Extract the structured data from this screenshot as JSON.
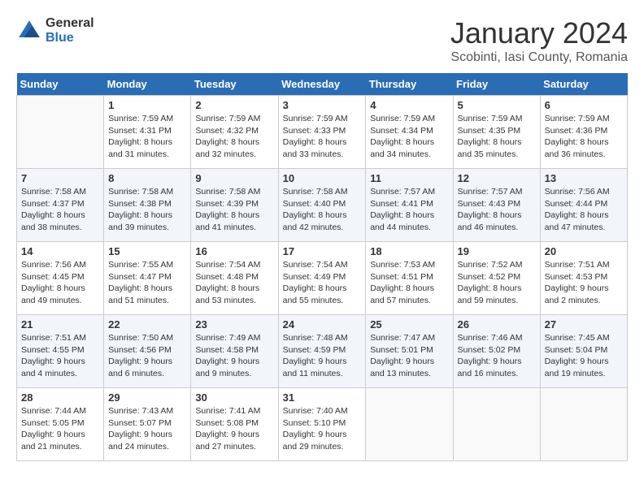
{
  "header": {
    "logo_line1": "General",
    "logo_line2": "Blue",
    "title": "January 2024",
    "subtitle": "Scobinti, Iasi County, Romania"
  },
  "weekdays": [
    "Sunday",
    "Monday",
    "Tuesday",
    "Wednesday",
    "Thursday",
    "Friday",
    "Saturday"
  ],
  "weeks": [
    [
      {
        "num": "",
        "info": ""
      },
      {
        "num": "1",
        "info": "Sunrise: 7:59 AM\nSunset: 4:31 PM\nDaylight: 8 hours\nand 31 minutes."
      },
      {
        "num": "2",
        "info": "Sunrise: 7:59 AM\nSunset: 4:32 PM\nDaylight: 8 hours\nand 32 minutes."
      },
      {
        "num": "3",
        "info": "Sunrise: 7:59 AM\nSunset: 4:33 PM\nDaylight: 8 hours\nand 33 minutes."
      },
      {
        "num": "4",
        "info": "Sunrise: 7:59 AM\nSunset: 4:34 PM\nDaylight: 8 hours\nand 34 minutes."
      },
      {
        "num": "5",
        "info": "Sunrise: 7:59 AM\nSunset: 4:35 PM\nDaylight: 8 hours\nand 35 minutes."
      },
      {
        "num": "6",
        "info": "Sunrise: 7:59 AM\nSunset: 4:36 PM\nDaylight: 8 hours\nand 36 minutes."
      }
    ],
    [
      {
        "num": "7",
        "info": "Sunrise: 7:58 AM\nSunset: 4:37 PM\nDaylight: 8 hours\nand 38 minutes."
      },
      {
        "num": "8",
        "info": "Sunrise: 7:58 AM\nSunset: 4:38 PM\nDaylight: 8 hours\nand 39 minutes."
      },
      {
        "num": "9",
        "info": "Sunrise: 7:58 AM\nSunset: 4:39 PM\nDaylight: 8 hours\nand 41 minutes."
      },
      {
        "num": "10",
        "info": "Sunrise: 7:58 AM\nSunset: 4:40 PM\nDaylight: 8 hours\nand 42 minutes."
      },
      {
        "num": "11",
        "info": "Sunrise: 7:57 AM\nSunset: 4:41 PM\nDaylight: 8 hours\nand 44 minutes."
      },
      {
        "num": "12",
        "info": "Sunrise: 7:57 AM\nSunset: 4:43 PM\nDaylight: 8 hours\nand 46 minutes."
      },
      {
        "num": "13",
        "info": "Sunrise: 7:56 AM\nSunset: 4:44 PM\nDaylight: 8 hours\nand 47 minutes."
      }
    ],
    [
      {
        "num": "14",
        "info": "Sunrise: 7:56 AM\nSunset: 4:45 PM\nDaylight: 8 hours\nand 49 minutes."
      },
      {
        "num": "15",
        "info": "Sunrise: 7:55 AM\nSunset: 4:47 PM\nDaylight: 8 hours\nand 51 minutes."
      },
      {
        "num": "16",
        "info": "Sunrise: 7:54 AM\nSunset: 4:48 PM\nDaylight: 8 hours\nand 53 minutes."
      },
      {
        "num": "17",
        "info": "Sunrise: 7:54 AM\nSunset: 4:49 PM\nDaylight: 8 hours\nand 55 minutes."
      },
      {
        "num": "18",
        "info": "Sunrise: 7:53 AM\nSunset: 4:51 PM\nDaylight: 8 hours\nand 57 minutes."
      },
      {
        "num": "19",
        "info": "Sunrise: 7:52 AM\nSunset: 4:52 PM\nDaylight: 8 hours\nand 59 minutes."
      },
      {
        "num": "20",
        "info": "Sunrise: 7:51 AM\nSunset: 4:53 PM\nDaylight: 9 hours\nand 2 minutes."
      }
    ],
    [
      {
        "num": "21",
        "info": "Sunrise: 7:51 AM\nSunset: 4:55 PM\nDaylight: 9 hours\nand 4 minutes."
      },
      {
        "num": "22",
        "info": "Sunrise: 7:50 AM\nSunset: 4:56 PM\nDaylight: 9 hours\nand 6 minutes."
      },
      {
        "num": "23",
        "info": "Sunrise: 7:49 AM\nSunset: 4:58 PM\nDaylight: 9 hours\nand 9 minutes."
      },
      {
        "num": "24",
        "info": "Sunrise: 7:48 AM\nSunset: 4:59 PM\nDaylight: 9 hours\nand 11 minutes."
      },
      {
        "num": "25",
        "info": "Sunrise: 7:47 AM\nSunset: 5:01 PM\nDaylight: 9 hours\nand 13 minutes."
      },
      {
        "num": "26",
        "info": "Sunrise: 7:46 AM\nSunset: 5:02 PM\nDaylight: 9 hours\nand 16 minutes."
      },
      {
        "num": "27",
        "info": "Sunrise: 7:45 AM\nSunset: 5:04 PM\nDaylight: 9 hours\nand 19 minutes."
      }
    ],
    [
      {
        "num": "28",
        "info": "Sunrise: 7:44 AM\nSunset: 5:05 PM\nDaylight: 9 hours\nand 21 minutes."
      },
      {
        "num": "29",
        "info": "Sunrise: 7:43 AM\nSunset: 5:07 PM\nDaylight: 9 hours\nand 24 minutes."
      },
      {
        "num": "30",
        "info": "Sunrise: 7:41 AM\nSunset: 5:08 PM\nDaylight: 9 hours\nand 27 minutes."
      },
      {
        "num": "31",
        "info": "Sunrise: 7:40 AM\nSunset: 5:10 PM\nDaylight: 9 hours\nand 29 minutes."
      },
      {
        "num": "",
        "info": ""
      },
      {
        "num": "",
        "info": ""
      },
      {
        "num": "",
        "info": ""
      }
    ]
  ]
}
